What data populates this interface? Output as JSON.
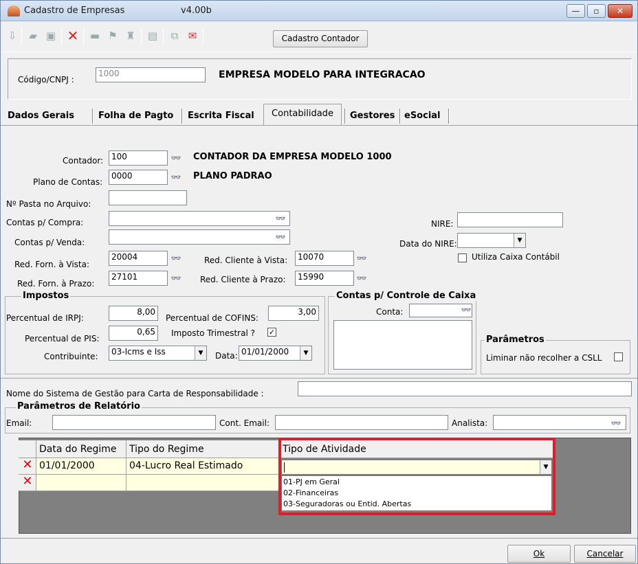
{
  "window": {
    "title": "Cadastro de Empresas",
    "version": "v4.00b",
    "minimize": "—",
    "maximize": "▫",
    "close": "✕"
  },
  "toolbar": {
    "cadastro_contador": "Cadastro Contador"
  },
  "header": {
    "codigo_label": "Código/CNPJ :",
    "codigo_value": "1000",
    "empresa_name": "EMPRESA MODELO PARA INTEGRACAO"
  },
  "tabs": [
    {
      "label": "Dados Gerais"
    },
    {
      "label": "Folha de Pagto"
    },
    {
      "label": "Escrita Fiscal"
    },
    {
      "label": "Contabilidade"
    },
    {
      "label": "Gestores"
    },
    {
      "label": "eSocial"
    }
  ],
  "contab": {
    "contador_label": "Contador:",
    "contador_value": "100",
    "contador_name": "CONTADOR DA EMPRESA MODELO 1000",
    "plano_label": "Plano de Contas:",
    "plano_value": "0000",
    "plano_name": "PLANO PADRAO",
    "pasta_label": "Nº Pasta no Arquivo:",
    "pasta_value": "",
    "compra_label": "Contas p/ Compra:",
    "compra_value": "",
    "venda_label": "Contas p/ Venda:",
    "venda_value": "",
    "nire_label": "NIRE:",
    "nire_value": "",
    "data_nire_label": "Data do NIRE:",
    "data_nire_value": "",
    "caixa_label": "Utiliza Caixa Contábil",
    "forn_vista_label": "Red. Forn. à Vista:",
    "forn_vista_value": "20004",
    "forn_prazo_label": "Red. Forn. à Prazo:",
    "forn_prazo_value": "27101",
    "cli_vista_label": "Red. Cliente à Vista:",
    "cli_vista_value": "10070",
    "cli_prazo_label": "Red. Cliente à Prazo:",
    "cli_prazo_value": "15990"
  },
  "impostos": {
    "title": "Impostos",
    "irpj_label": "Percentual de IRPJ:",
    "irpj_value": "8,00",
    "cofins_label": "Percentual de COFINS:",
    "cofins_value": "3,00",
    "pis_label": "Percentual de PIS:",
    "pis_value": "0,65",
    "trimestral_label": "Imposto Trimestral ?",
    "trimestral_check": "✓",
    "contrib_label": "Contribuinte:",
    "contrib_value": "03-Icms e Iss",
    "data_label": "Data:",
    "data_value": "01/01/2000"
  },
  "caixa": {
    "title": "Contas p/ Controle de Caixa",
    "conta_label": "Conta:",
    "conta_value": ""
  },
  "parametros": {
    "title": "Parâmetros",
    "csll_label": "Liminar não recolher a CSLL"
  },
  "sistema_label": "Nome do  Sistema de Gestão para Carta de Responsabilidade :",
  "relatorio": {
    "title": "Parâmetros de Relatório",
    "email_label": "Email:",
    "cont_email_label": "Cont. Email:",
    "analista_label": "Analista:"
  },
  "grid": {
    "headers": [
      "Data do Regime",
      "Tipo do Regime",
      "Tipo de Atividade"
    ],
    "rows": [
      {
        "data": "01/01/2000",
        "tipo": "04-Lucro Real Estimado"
      },
      {
        "data": "",
        "tipo": ""
      }
    ],
    "dropdown_options": [
      "01-PJ em Geral",
      "02-Financeiras",
      "03-Seguradoras ou Entid. Abertas"
    ],
    "highlight_color": "#e01e2a"
  },
  "footer": {
    "ok": "Ok",
    "cancelar": "Cancelar"
  }
}
